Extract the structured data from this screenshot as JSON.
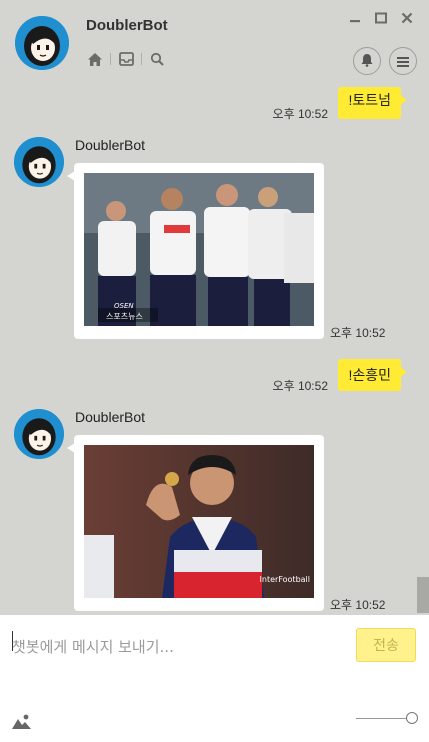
{
  "window": {
    "title": "DoublerBot",
    "controls": [
      "minimize-icon",
      "maximize-icon",
      "close-icon"
    ],
    "toolbar_icons": [
      "home-icon",
      "inbox-icon",
      "search-icon"
    ],
    "right_buttons": [
      "bell-icon",
      "menu-icon"
    ]
  },
  "messages": [
    {
      "type": "sent",
      "text": "!토트넘",
      "time": "오후 10:52"
    },
    {
      "type": "received",
      "sender": "DoublerBot",
      "content": "image",
      "image_caption": "스포츠뉴스",
      "image_watermark": "OSEN",
      "time": "오후 10:52"
    },
    {
      "type": "sent",
      "text": "!손흥민",
      "time": "오후 10:52"
    },
    {
      "type": "received",
      "sender": "DoublerBot",
      "content": "image",
      "image_watermark": "InterFootball",
      "time": "오후 10:52"
    }
  ],
  "composer": {
    "placeholder": "챗봇에게 메시지 보내기...",
    "send_label": "전송"
  },
  "colors": {
    "chat_bg": "#d4d5d0",
    "sent_bubble": "#ffeb33",
    "send_button": "#fff28c",
    "avatar_bg": "#1f8fd0"
  }
}
